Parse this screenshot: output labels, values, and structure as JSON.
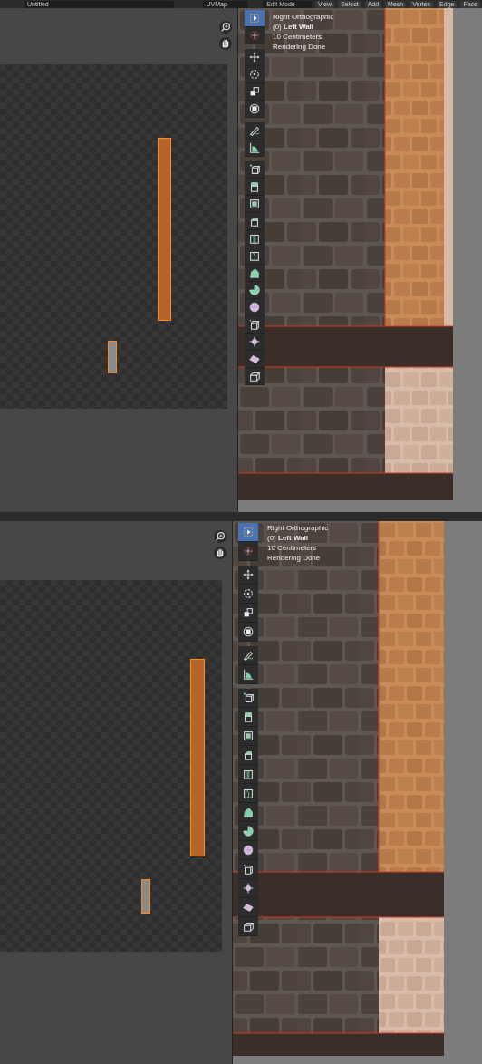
{
  "panels": [
    {
      "header": {
        "file_name": "Untitled",
        "uv_map": "UVMap",
        "mode": "Edit Mode",
        "menus": [
          "View",
          "Select",
          "Add",
          "Mesh",
          "Vertex",
          "Edge",
          "Face"
        ]
      },
      "tools": [
        {
          "selected": true
        },
        {
          "selected": false
        },
        {
          "selected": false
        },
        {
          "selected": false
        },
        {
          "selected": false
        },
        {
          "selected": false
        },
        {
          "selected": false
        },
        {
          "selected": false
        },
        {
          "selected": false
        },
        {
          "selected": false
        },
        {
          "selected": false
        },
        {
          "selected": false
        },
        {
          "selected": false
        },
        {
          "selected": false
        },
        {
          "selected": false
        },
        {
          "selected": false
        },
        {
          "selected": false
        },
        {
          "selected": false
        },
        {
          "selected": false
        },
        {
          "selected": false
        },
        {
          "selected": false
        }
      ],
      "overlay": [
        "Right Orthographic",
        "(0) **Left Wall**",
        "10 Centimeters",
        "Rendering Done"
      ]
    },
    {
      "tools": [
        {
          "selected": true
        },
        {
          "selected": false
        },
        {
          "selected": false
        },
        {
          "selected": false
        },
        {
          "selected": false
        },
        {
          "selected": false
        },
        {
          "selected": false
        },
        {
          "selected": false
        },
        {
          "selected": false
        },
        {
          "selected": false
        },
        {
          "selected": false
        },
        {
          "selected": false
        },
        {
          "selected": false
        },
        {
          "selected": false
        },
        {
          "selected": false
        },
        {
          "selected": false
        },
        {
          "selected": false
        },
        {
          "selected": false
        },
        {
          "selected": false
        },
        {
          "selected": false
        },
        {
          "selected": false
        }
      ],
      "overlay": [
        "Right Orthographic",
        "(0) **Left Wall**",
        "10 Centimeters",
        "Rendering Done"
      ]
    }
  ]
}
